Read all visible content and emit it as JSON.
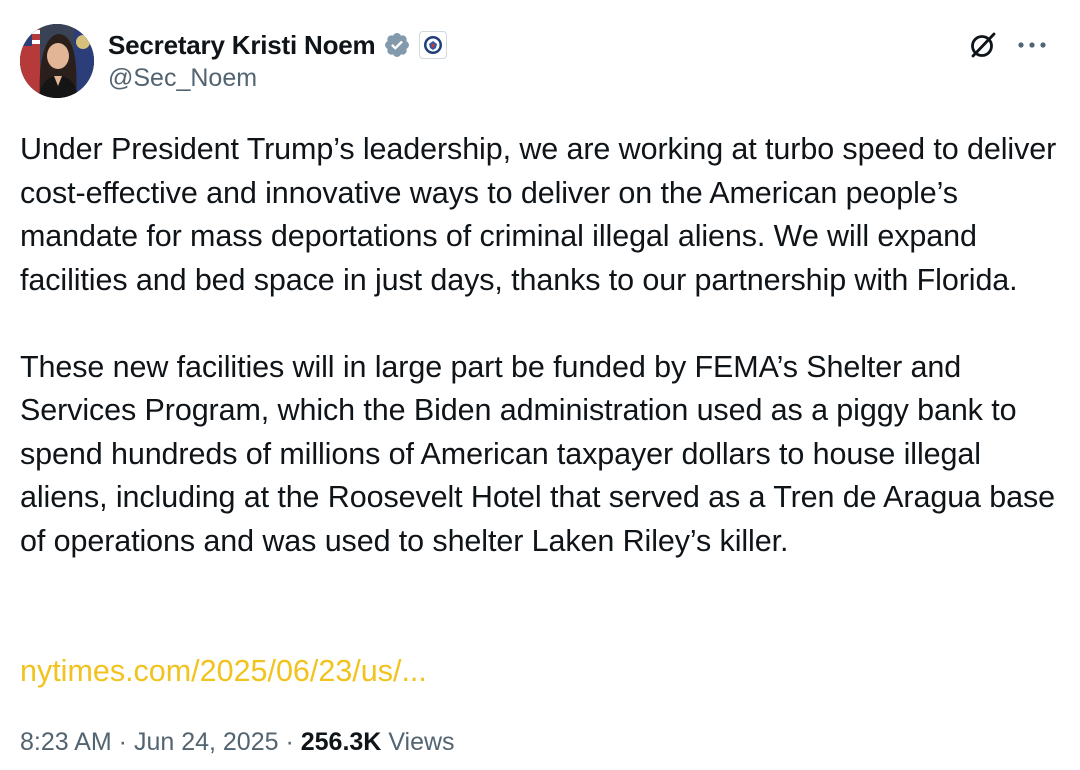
{
  "author": {
    "display_name": "Secretary Kristi Noem",
    "handle": "@Sec_Noem",
    "verified_badge_icon": "verified-badge-icon",
    "affiliation_badge_icon": "dhs-seal-icon",
    "avatar_icon": "avatar"
  },
  "header_actions": {
    "grok_icon": "grok-icon",
    "more_icon": "more-options-icon"
  },
  "tweet": {
    "paragraphs": [
      "Under President Trump’s leadership, we are working at turbo speed to deliver cost-effective and innovative ways to deliver on the American people’s mandate for mass deportations of criminal illegal aliens. We will expand facilities and bed space in just days, thanks to our partnership with Florida.",
      "These new facilities will in large part be funded by FEMA’s Shelter and Services Program, which the Biden administration used as a piggy bank to spend hundreds of millions of American taxpayer dollars to house illegal aliens, including at the Roosevelt Hotel that served as a Tren de Aragua base of operations and was used to shelter Laken Riley’s killer."
    ],
    "link_text": "nytimes.com/2025/06/23/us/..."
  },
  "meta": {
    "time": "8:23 AM",
    "separator": " · ",
    "date": "Jun 24, 2025",
    "views_count": "256.3K",
    "views_label": " Views"
  },
  "colors": {
    "text_primary": "#0f1419",
    "text_secondary": "#536471",
    "link": "#f2c31e",
    "verified_badge": "#829aab"
  }
}
